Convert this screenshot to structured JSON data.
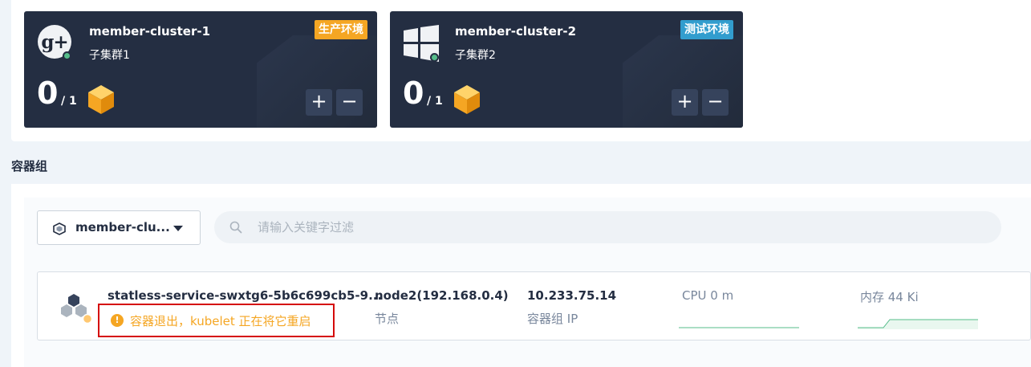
{
  "clusters": [
    {
      "name": "member-cluster-1",
      "alias": "子集群1",
      "env_tag": "生产环境",
      "env_color": "#f5a623",
      "icon": "google-plus-icon",
      "status_color": "#55bc8a",
      "count": "0",
      "total": "/ 1"
    },
    {
      "name": "member-cluster-2",
      "alias": "子集群2",
      "env_tag": "测试环境",
      "env_color": "#329dce",
      "icon": "windows-icon",
      "status_color": "#55bc8a",
      "count": "0",
      "total": "/ 1"
    }
  ],
  "controls": {
    "plus_label": "+",
    "minus_label": "−"
  },
  "section": {
    "title": "容器组"
  },
  "filter": {
    "cluster_selected": "member-clu...",
    "search_placeholder": "请输入关键字过滤"
  },
  "pod": {
    "name": "statless-service-swxtg6-5b6c699cb5-9...",
    "warning": "容器退出，kubelet 正在将它重启",
    "node_value": "node2(192.168.0.4)",
    "node_label": "节点",
    "ip_value": "10.233.75.14",
    "ip_label": "容器组 IP",
    "cpu_label": "CPU 0 m",
    "memory_label": "内存 44 Ki"
  },
  "colors": {
    "card_bg": "#242e42",
    "warning": "#f5a623",
    "highlight_border": "#d50a0a",
    "sparkline": "#55bc8a"
  }
}
